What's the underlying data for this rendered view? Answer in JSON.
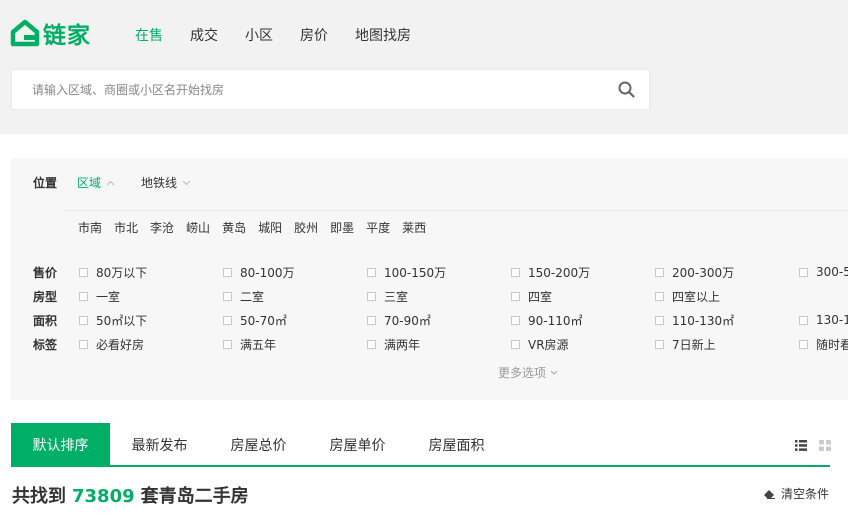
{
  "brand": {
    "name": "链家",
    "color": "#00ae66",
    "icon": "home-outline-icon"
  },
  "nav": [
    {
      "label": "在售",
      "active": true
    },
    {
      "label": "成交",
      "active": false
    },
    {
      "label": "小区",
      "active": false
    },
    {
      "label": "房价",
      "active": false
    },
    {
      "label": "地图找房",
      "active": false
    }
  ],
  "search": {
    "placeholder": "请输入区域、商圈或小区名开始找房",
    "icon": "search-icon"
  },
  "filter": {
    "position_label": "位置",
    "position_tabs": [
      {
        "label": "区域",
        "active": true,
        "icon": "chevron-up-icon"
      },
      {
        "label": "地铁线",
        "active": false,
        "icon": "chevron-down-icon"
      }
    ],
    "districts": [
      "市南",
      "市北",
      "李沧",
      "崂山",
      "黄岛",
      "城阳",
      "胶州",
      "即墨",
      "平度",
      "莱西"
    ],
    "rows": [
      {
        "label": "售价",
        "options": [
          "80万以下",
          "80-100万",
          "100-150万",
          "150-200万",
          "200-300万",
          "300-5"
        ]
      },
      {
        "label": "房型",
        "options": [
          "一室",
          "二室",
          "三室",
          "四室",
          "四室以上"
        ]
      },
      {
        "label": "面积",
        "options": [
          "50㎡以下",
          "50-70㎡",
          "70-90㎡",
          "90-110㎡",
          "110-130㎡",
          "130-1"
        ]
      },
      {
        "label": "标签",
        "options": [
          "必看好房",
          "满五年",
          "满两年",
          "VR房源",
          "7日新上",
          "随时看"
        ]
      }
    ],
    "more_label": "更多选项"
  },
  "sort_tabs": [
    {
      "label": "默认排序",
      "active": true
    },
    {
      "label": "最新发布",
      "active": false
    },
    {
      "label": "房屋总价",
      "active": false
    },
    {
      "label": "房屋单价",
      "active": false
    },
    {
      "label": "房屋面积",
      "active": false
    }
  ],
  "view_toggle": {
    "list_icon": "list-view-icon",
    "grid_icon": "grid-view-icon"
  },
  "result": {
    "prefix": "共找到",
    "count": "73809",
    "suffix": "套青岛二手房"
  },
  "clear": {
    "label": "清空条件",
    "icon": "eraser-icon"
  }
}
